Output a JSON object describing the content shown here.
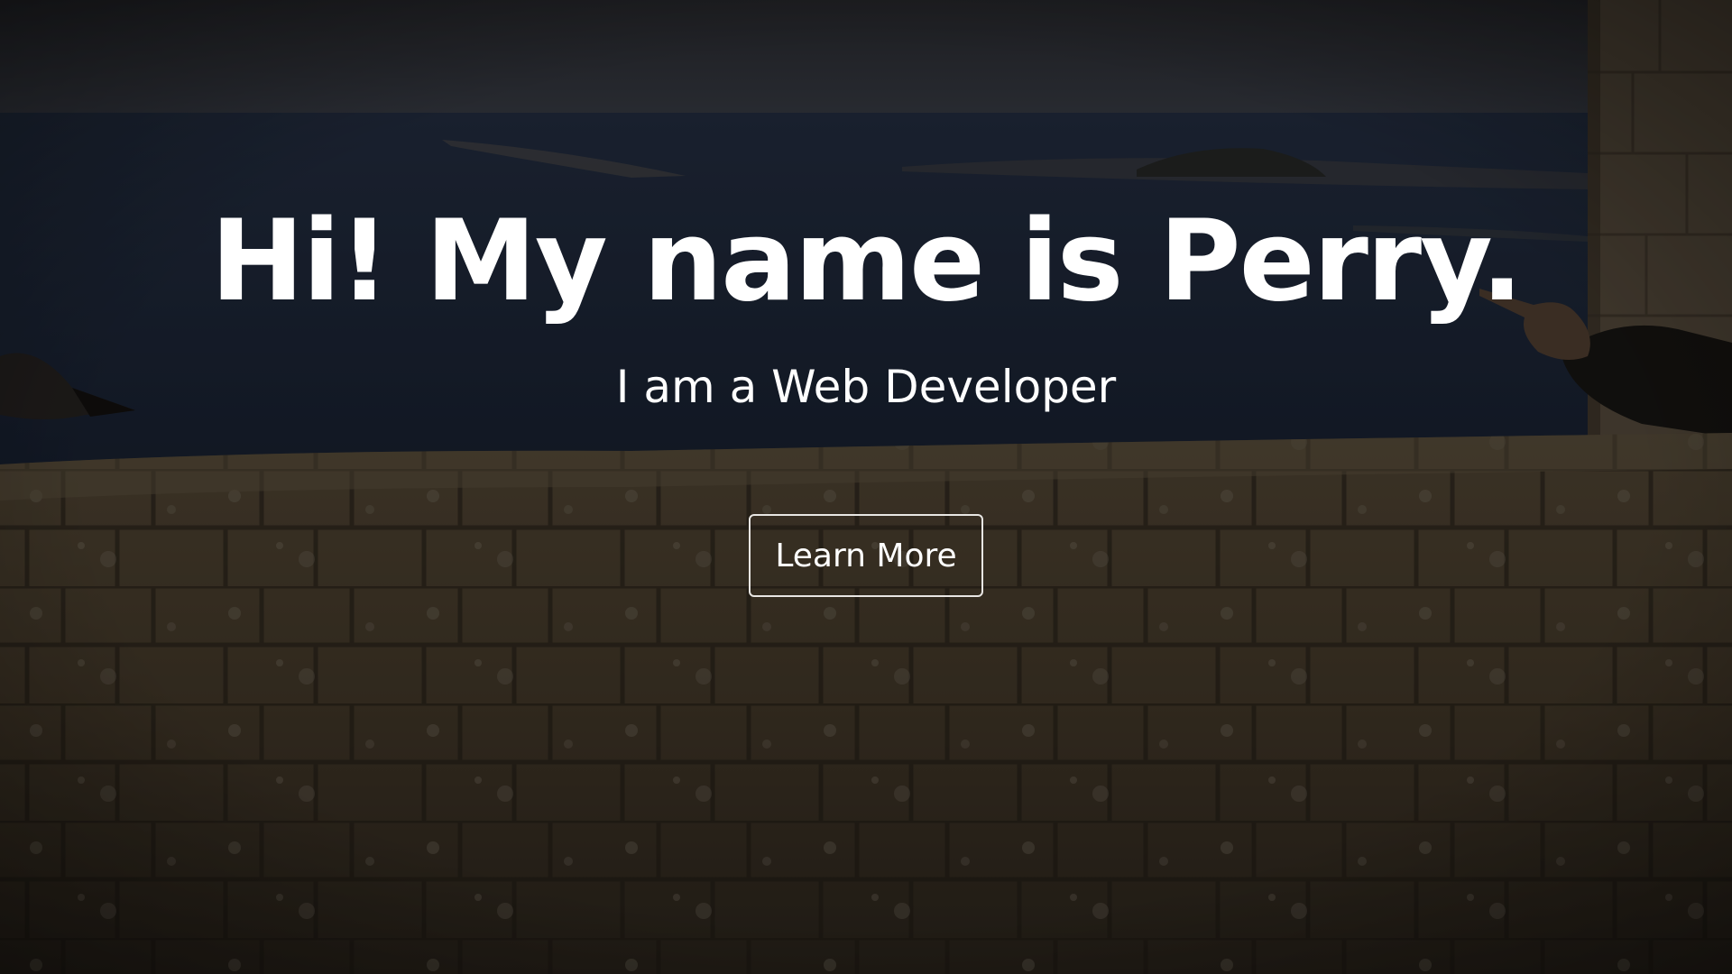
{
  "hero": {
    "headline": "Hi! My name is Perry.",
    "subheadline": "I am a Web Developer",
    "cta_label": "Learn More"
  },
  "colors": {
    "text": "#ffffff",
    "button_border": "#e8e6e3",
    "sky": "#3a3c44",
    "sea": "#1f2a3c",
    "wall": "#4a3f30"
  }
}
